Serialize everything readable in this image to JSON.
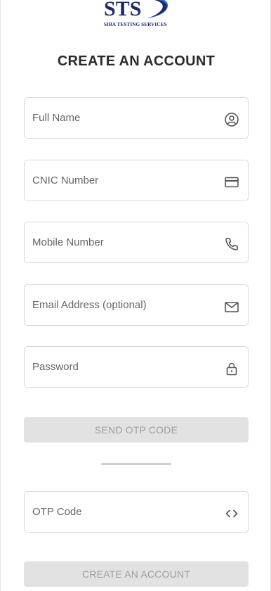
{
  "brand": {
    "logo_text": "STS",
    "tagline": "SIBA TESTING SERVICES"
  },
  "page": {
    "title": "CREATE AN ACCOUNT"
  },
  "form": {
    "full_name": {
      "placeholder": "Full Name",
      "icon": "user-circle-icon"
    },
    "cnic": {
      "placeholder": "CNIC Number",
      "icon": "id-card-icon"
    },
    "mobile": {
      "placeholder": "Mobile Number",
      "icon": "phone-icon"
    },
    "email": {
      "placeholder": "Email Address (optional)",
      "icon": "envelope-icon"
    },
    "password": {
      "placeholder": "Password",
      "icon": "lock-icon"
    },
    "send_otp_label": "SEND OTP CODE",
    "otp": {
      "placeholder": "OTP Code",
      "icon": "code-icon"
    },
    "create_account_label": "CREATE AN ACCOUNT"
  },
  "colors": {
    "brand_navy": "#1f2a6e",
    "brand_blue": "#2a6fd6",
    "disabled_button_bg": "#e2e2e2",
    "disabled_button_text": "#9e9e9e",
    "field_border": "#d9d9d9"
  }
}
